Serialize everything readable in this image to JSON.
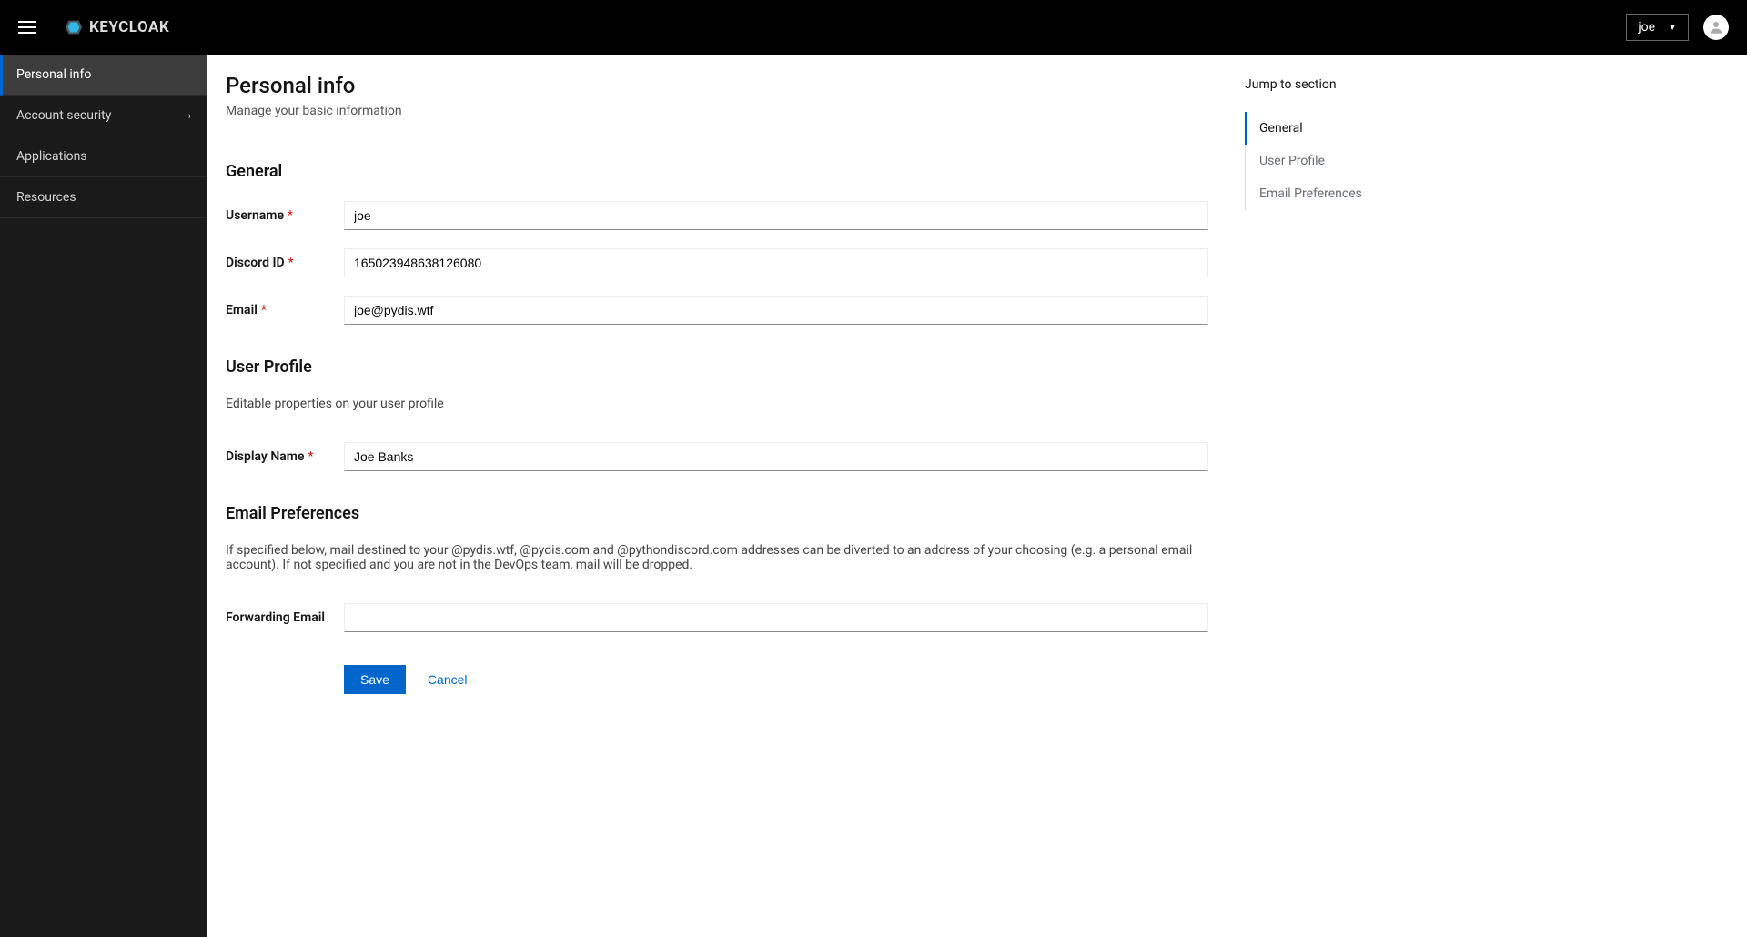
{
  "header": {
    "logo_text": "KEYCLOAK",
    "user_label": "joe"
  },
  "sidebar": {
    "items": [
      {
        "label": "Personal info",
        "active": true,
        "expandable": false
      },
      {
        "label": "Account security",
        "active": false,
        "expandable": true
      },
      {
        "label": "Applications",
        "active": false,
        "expandable": false
      },
      {
        "label": "Resources",
        "active": false,
        "expandable": false
      }
    ]
  },
  "page": {
    "title": "Personal info",
    "subtitle": "Manage your basic information"
  },
  "sections": {
    "general": {
      "title": "General",
      "fields": {
        "username": {
          "label": "Username",
          "required": true,
          "value": "joe"
        },
        "discord_id": {
          "label": "Discord ID",
          "required": true,
          "value": "165023948638126080"
        },
        "email": {
          "label": "Email",
          "required": true,
          "value": "joe@pydis.wtf"
        }
      }
    },
    "user_profile": {
      "title": "User Profile",
      "desc": "Editable properties on your user profile",
      "fields": {
        "display_name": {
          "label": "Display Name",
          "required": true,
          "value": "Joe Banks"
        }
      }
    },
    "email_prefs": {
      "title": "Email Preferences",
      "desc": "If specified below, mail destined to your @pydis.wtf, @pydis.com and @pythondiscord.com addresses can be diverted to an address of your choosing (e.g. a personal email account). If not specified and you are not in the DevOps team, mail will be dropped.",
      "fields": {
        "forwarding_email": {
          "label": "Forwarding Email",
          "required": false,
          "value": ""
        }
      }
    }
  },
  "actions": {
    "save": "Save",
    "cancel": "Cancel"
  },
  "jumpnav": {
    "title": "Jump to section",
    "items": [
      {
        "label": "General",
        "active": true
      },
      {
        "label": "User Profile",
        "active": false
      },
      {
        "label": "Email Preferences",
        "active": false
      }
    ]
  }
}
